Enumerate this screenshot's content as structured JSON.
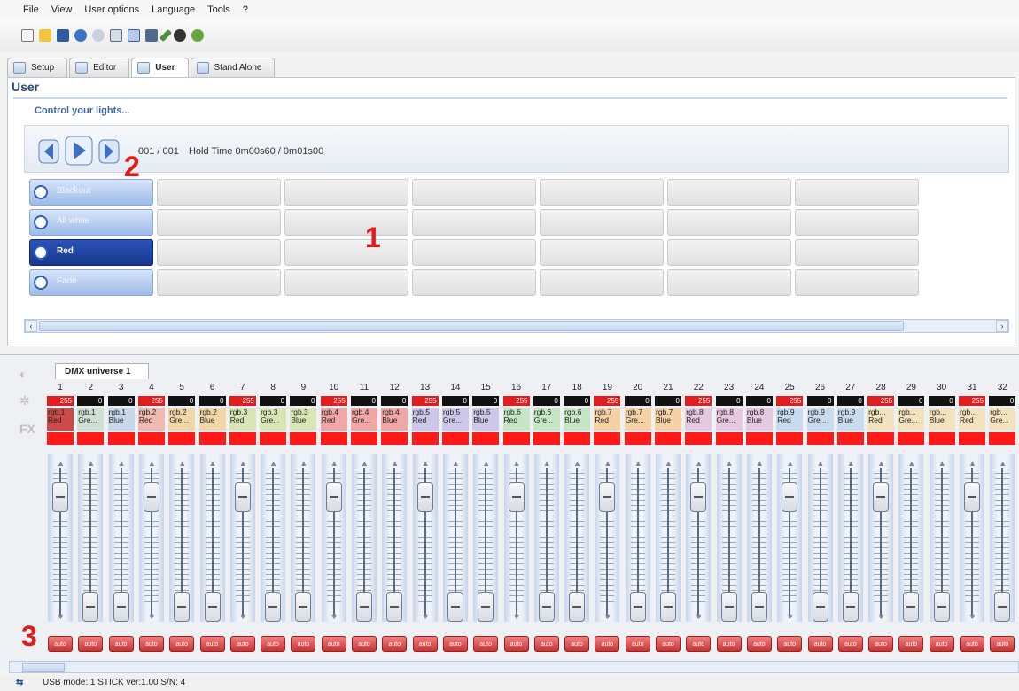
{
  "menu": [
    "File",
    "View",
    "User options",
    "Language",
    "Tools",
    "?"
  ],
  "toolbar": {
    "icons": [
      "new-file-icon",
      "open-folder-icon",
      "save-icon",
      "undo-icon",
      "redo-icon",
      "grid-icon",
      "grid-active-icon",
      "monitor-icon",
      "pen-icon",
      "record-icon",
      "help-icon"
    ]
  },
  "tabs": [
    {
      "label": "Setup"
    },
    {
      "label": "Editor"
    },
    {
      "label": "User"
    },
    {
      "label": "Stand Alone"
    }
  ],
  "panel": {
    "title": "User",
    "subtitle": "Control your lights...",
    "progress": "001 / 001",
    "hold": "Hold Time 0m00s60 / 0m01s00"
  },
  "scenes": [
    {
      "label": "Blackout"
    },
    {
      "label": "All white"
    },
    {
      "label": "Red"
    },
    {
      "label": "Fade"
    }
  ],
  "dmx": {
    "tab": "DMX universe 1",
    "auto_label": "auto"
  },
  "channels": [
    {
      "n": "1",
      "val": "255",
      "lbl": "rgb.1 Red",
      "c": "#cc4a4a",
      "pos": 0.97
    },
    {
      "n": "2",
      "val": "0",
      "lbl": "rgb.1 Gre...",
      "c": "#cfe0d2",
      "pos": 0.0
    },
    {
      "n": "3",
      "val": "0",
      "lbl": "rgb.1 Blue",
      "c": "#c9d7ea",
      "pos": 0.0
    },
    {
      "n": "4",
      "val": "255",
      "lbl": "rgb.2 Red",
      "c": "#f1b9b0",
      "pos": 0.97
    },
    {
      "n": "5",
      "val": "0",
      "lbl": "rgb.2 Gre...",
      "c": "#f1d7a8",
      "pos": 0.0
    },
    {
      "n": "6",
      "val": "0",
      "lbl": "rgb.2 Blue",
      "c": "#f1d7a8",
      "pos": 0.0
    },
    {
      "n": "7",
      "val": "255",
      "lbl": "rgb.3 Red",
      "c": "#d7e6b4",
      "pos": 0.97
    },
    {
      "n": "8",
      "val": "0",
      "lbl": "rgb.3 Gre...",
      "c": "#d7e6b4",
      "pos": 0.0
    },
    {
      "n": "9",
      "val": "0",
      "lbl": "rgb.3 Blue",
      "c": "#d7e6b4",
      "pos": 0.0
    },
    {
      "n": "10",
      "val": "255",
      "lbl": "rgb.4 Red",
      "c": "#f1a7a7",
      "pos": 0.97
    },
    {
      "n": "11",
      "val": "0",
      "lbl": "rgb.4 Gre...",
      "c": "#f1a7a7",
      "pos": 0.0
    },
    {
      "n": "12",
      "val": "0",
      "lbl": "rgb.4 Blue",
      "c": "#f1a7a7",
      "pos": 0.0
    },
    {
      "n": "13",
      "val": "255",
      "lbl": "rgb.5 Red",
      "c": "#cfc7ea",
      "pos": 0.97
    },
    {
      "n": "14",
      "val": "0",
      "lbl": "rgb.5 Gre...",
      "c": "#cfc7ea",
      "pos": 0.0
    },
    {
      "n": "15",
      "val": "0",
      "lbl": "rgb.5 Blue",
      "c": "#cfc7ea",
      "pos": 0.0
    },
    {
      "n": "16",
      "val": "255",
      "lbl": "rgb.6 Red",
      "c": "#c6e6c6",
      "pos": 0.97
    },
    {
      "n": "17",
      "val": "0",
      "lbl": "rgb.6 Gre...",
      "c": "#c6e6c6",
      "pos": 0.0
    },
    {
      "n": "18",
      "val": "0",
      "lbl": "rgb.6 Blue",
      "c": "#c6e6c6",
      "pos": 0.0
    },
    {
      "n": "19",
      "val": "255",
      "lbl": "rgb.7 Red",
      "c": "#f6d1a6",
      "pos": 0.97
    },
    {
      "n": "20",
      "val": "0",
      "lbl": "rgb.7 Gre...",
      "c": "#f6d1a6",
      "pos": 0.0
    },
    {
      "n": "21",
      "val": "0",
      "lbl": "rgb.7 Blue",
      "c": "#f6d1a6",
      "pos": 0.0
    },
    {
      "n": "22",
      "val": "255",
      "lbl": "rgb.8 Red",
      "c": "#e6c9e0",
      "pos": 0.97
    },
    {
      "n": "23",
      "val": "0",
      "lbl": "rgb.8 Gre...",
      "c": "#e6c9e0",
      "pos": 0.0
    },
    {
      "n": "24",
      "val": "0",
      "lbl": "rgb.8 Blue",
      "c": "#e6c9e0",
      "pos": 0.0
    },
    {
      "n": "25",
      "val": "255",
      "lbl": "rgb.9 Red",
      "c": "#c9dcef",
      "pos": 0.97
    },
    {
      "n": "26",
      "val": "0",
      "lbl": "rgb.9 Gre...",
      "c": "#c9dcef",
      "pos": 0.0
    },
    {
      "n": "27",
      "val": "0",
      "lbl": "rgb.9 Blue",
      "c": "#c9dcef",
      "pos": 0.0
    },
    {
      "n": "28",
      "val": "255",
      "lbl": "rgb... Red",
      "c": "#f2e2bd",
      "pos": 0.97
    },
    {
      "n": "29",
      "val": "0",
      "lbl": "rgb... Gre...",
      "c": "#f2e2bd",
      "pos": 0.0
    },
    {
      "n": "30",
      "val": "0",
      "lbl": "rgb... Blue",
      "c": "#f2e2bd",
      "pos": 0.0
    },
    {
      "n": "31",
      "val": "255",
      "lbl": "rgb... Red",
      "c": "#f2e2bd",
      "pos": 0.97
    },
    {
      "n": "32",
      "val": "0",
      "lbl": "rgb... Gre...",
      "c": "#f2e2bd",
      "pos": 0.0
    }
  ],
  "status": {
    "text": "USB mode: 1 STICK  ver:1.00  S/N: 4"
  },
  "annotations": {
    "a1": "1",
    "a2": "2",
    "a3": "3"
  },
  "colors": {
    "accent": "#2b5fc2",
    "selected": "#173a8f",
    "red": "#e11a1a"
  }
}
